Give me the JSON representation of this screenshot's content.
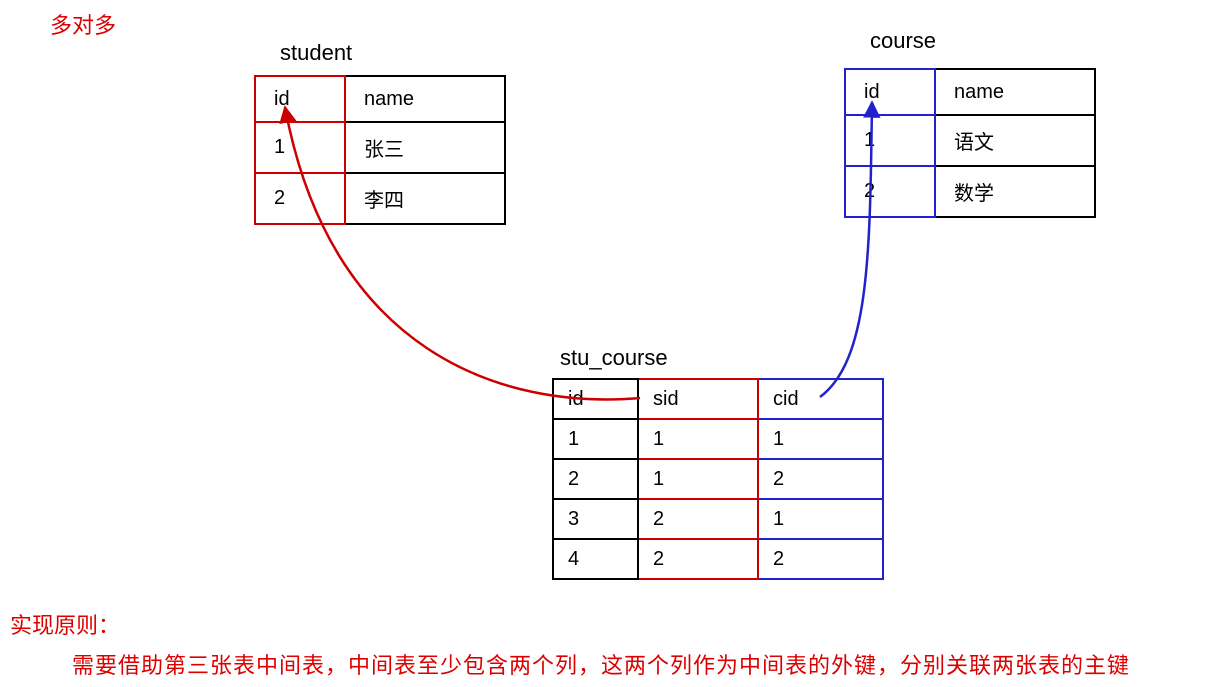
{
  "title": "多对多",
  "tables": {
    "student": {
      "label": "student",
      "header": {
        "id": "id",
        "name": "name"
      },
      "rows": [
        {
          "id": "1",
          "name": "张三"
        },
        {
          "id": "2",
          "name": "李四"
        }
      ]
    },
    "course": {
      "label": "course",
      "header": {
        "id": "id",
        "name": "name"
      },
      "rows": [
        {
          "id": "1",
          "name": "语文"
        },
        {
          "id": "2",
          "name": "数学"
        }
      ]
    },
    "stu_course": {
      "label": "stu_course",
      "header": {
        "id": "id",
        "sid": "sid",
        "cid": "cid"
      },
      "rows": [
        {
          "id": "1",
          "sid": "1",
          "cid": "1"
        },
        {
          "id": "2",
          "sid": "1",
          "cid": "2"
        },
        {
          "id": "3",
          "sid": "2",
          "cid": "1"
        },
        {
          "id": "4",
          "sid": "2",
          "cid": "2"
        }
      ]
    }
  },
  "principle": {
    "label": "实现原则：",
    "text": "需要借助第三张表中间表，中间表至少包含两个列，这两个列作为中间表的外键，分别关联两张表的主键"
  },
  "arrows": {
    "sid_to_student_id": {
      "from": "stu_course.sid",
      "to": "student.id",
      "color": "#c00"
    },
    "cid_to_course_id": {
      "from": "stu_course.cid",
      "to": "course.id",
      "color": "#22c"
    }
  },
  "chart_data": {
    "type": "table",
    "description": "Entity-relationship diagram: many-to-many between student and course via junction table stu_course",
    "entities": [
      {
        "name": "student",
        "columns": [
          "id",
          "name"
        ],
        "pk": "id",
        "rows": [
          {
            "id": 1,
            "name": "张三"
          },
          {
            "id": 2,
            "name": "李四"
          }
        ]
      },
      {
        "name": "course",
        "columns": [
          "id",
          "name"
        ],
        "pk": "id",
        "rows": [
          {
            "id": 1,
            "name": "语文"
          },
          {
            "id": 2,
            "name": "数学"
          }
        ]
      },
      {
        "name": "stu_course",
        "columns": [
          "id",
          "sid",
          "cid"
        ],
        "pk": "id",
        "fks": [
          {
            "column": "sid",
            "references": "student.id"
          },
          {
            "column": "cid",
            "references": "course.id"
          }
        ],
        "rows": [
          {
            "id": 1,
            "sid": 1,
            "cid": 1
          },
          {
            "id": 2,
            "sid": 1,
            "cid": 2
          },
          {
            "id": 3,
            "sid": 2,
            "cid": 1
          },
          {
            "id": 4,
            "sid": 2,
            "cid": 2
          }
        ]
      }
    ],
    "relationship": "many-to-many"
  }
}
